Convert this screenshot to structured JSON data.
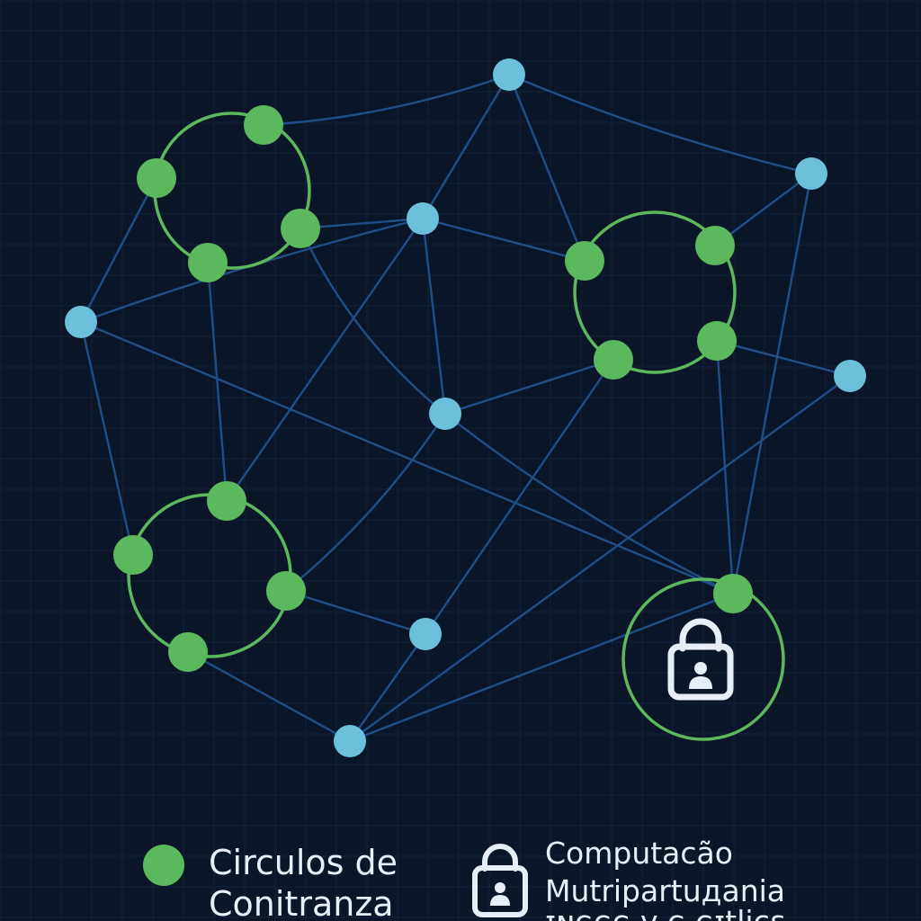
{
  "colors": {
    "background": "#0a1628",
    "grid": "#12223a",
    "edge": "#1f4f86",
    "trust_node": "#5cb85c",
    "trust_ring": "#5cb85c",
    "public_node": "#6cc0dc",
    "lock": "#e8eef5",
    "text": "#e8eef5"
  },
  "icons": {
    "diagram_lock": "lock-user-icon",
    "legend_lock": "lock-user-icon",
    "legend_circle": "green-dot-icon"
  },
  "legend": {
    "trust_circles": {
      "line1": "Circulos de",
      "line2": "Conitranza"
    },
    "mpc": {
      "line1": "Computacão",
      "line2": "Mutripartuдania",
      "line3": "ɪɴɢɢɢ ᴠ ɢ ɢɪtlicɛ"
    }
  }
}
